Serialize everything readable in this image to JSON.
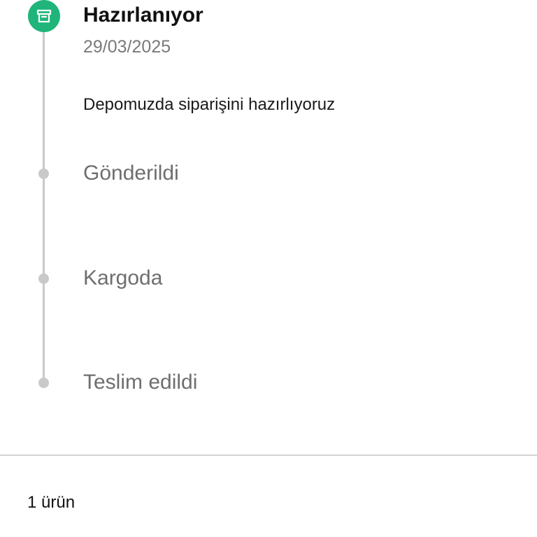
{
  "timeline": {
    "accent_color": "#1fb57a",
    "pending_color": "#c9c9c9",
    "steps": [
      {
        "title": "Hazırlanıyor",
        "date": "29/03/2025",
        "description": "Depomuzda siparişini hazırlıyoruz",
        "status": "active",
        "icon": "box-icon"
      },
      {
        "title": "Gönderildi",
        "status": "pending"
      },
      {
        "title": "Kargoda",
        "status": "pending"
      },
      {
        "title": "Teslim edildi",
        "status": "pending"
      }
    ]
  },
  "summary": {
    "item_count_label": "1 ürün"
  }
}
